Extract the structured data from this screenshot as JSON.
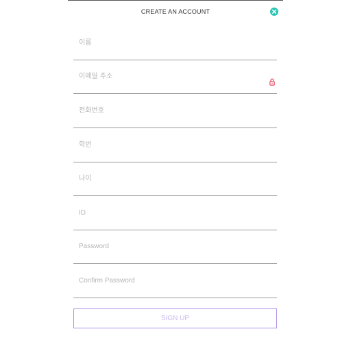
{
  "header": {
    "title": "CREATE AN ACCOUNT",
    "close_icon": "close-icon"
  },
  "form": {
    "fields": [
      {
        "name": "name-field",
        "placeholder": "이름",
        "value": ""
      },
      {
        "name": "email-field",
        "placeholder": "이메일 주소",
        "value": ""
      },
      {
        "name": "phone-field",
        "placeholder": "전화번호",
        "value": ""
      },
      {
        "name": "student-id-field",
        "placeholder": "학번",
        "value": ""
      },
      {
        "name": "age-field",
        "placeholder": "나이",
        "value": ""
      },
      {
        "name": "id-field",
        "placeholder": "ID",
        "value": ""
      },
      {
        "name": "password-field",
        "placeholder": "Password",
        "value": ""
      },
      {
        "name": "confirm-password-field",
        "placeholder": "Confirm Password",
        "value": ""
      }
    ],
    "email_field_icon": "lock-icon",
    "submit_label": "SIGN UP"
  },
  "colors": {
    "close_button": "#2ec4b6",
    "lock_icon": "#e8354e",
    "signup_border": "#a98ee8",
    "signup_text": "#c9b9f0",
    "field_underline": "#9a9a9a"
  }
}
